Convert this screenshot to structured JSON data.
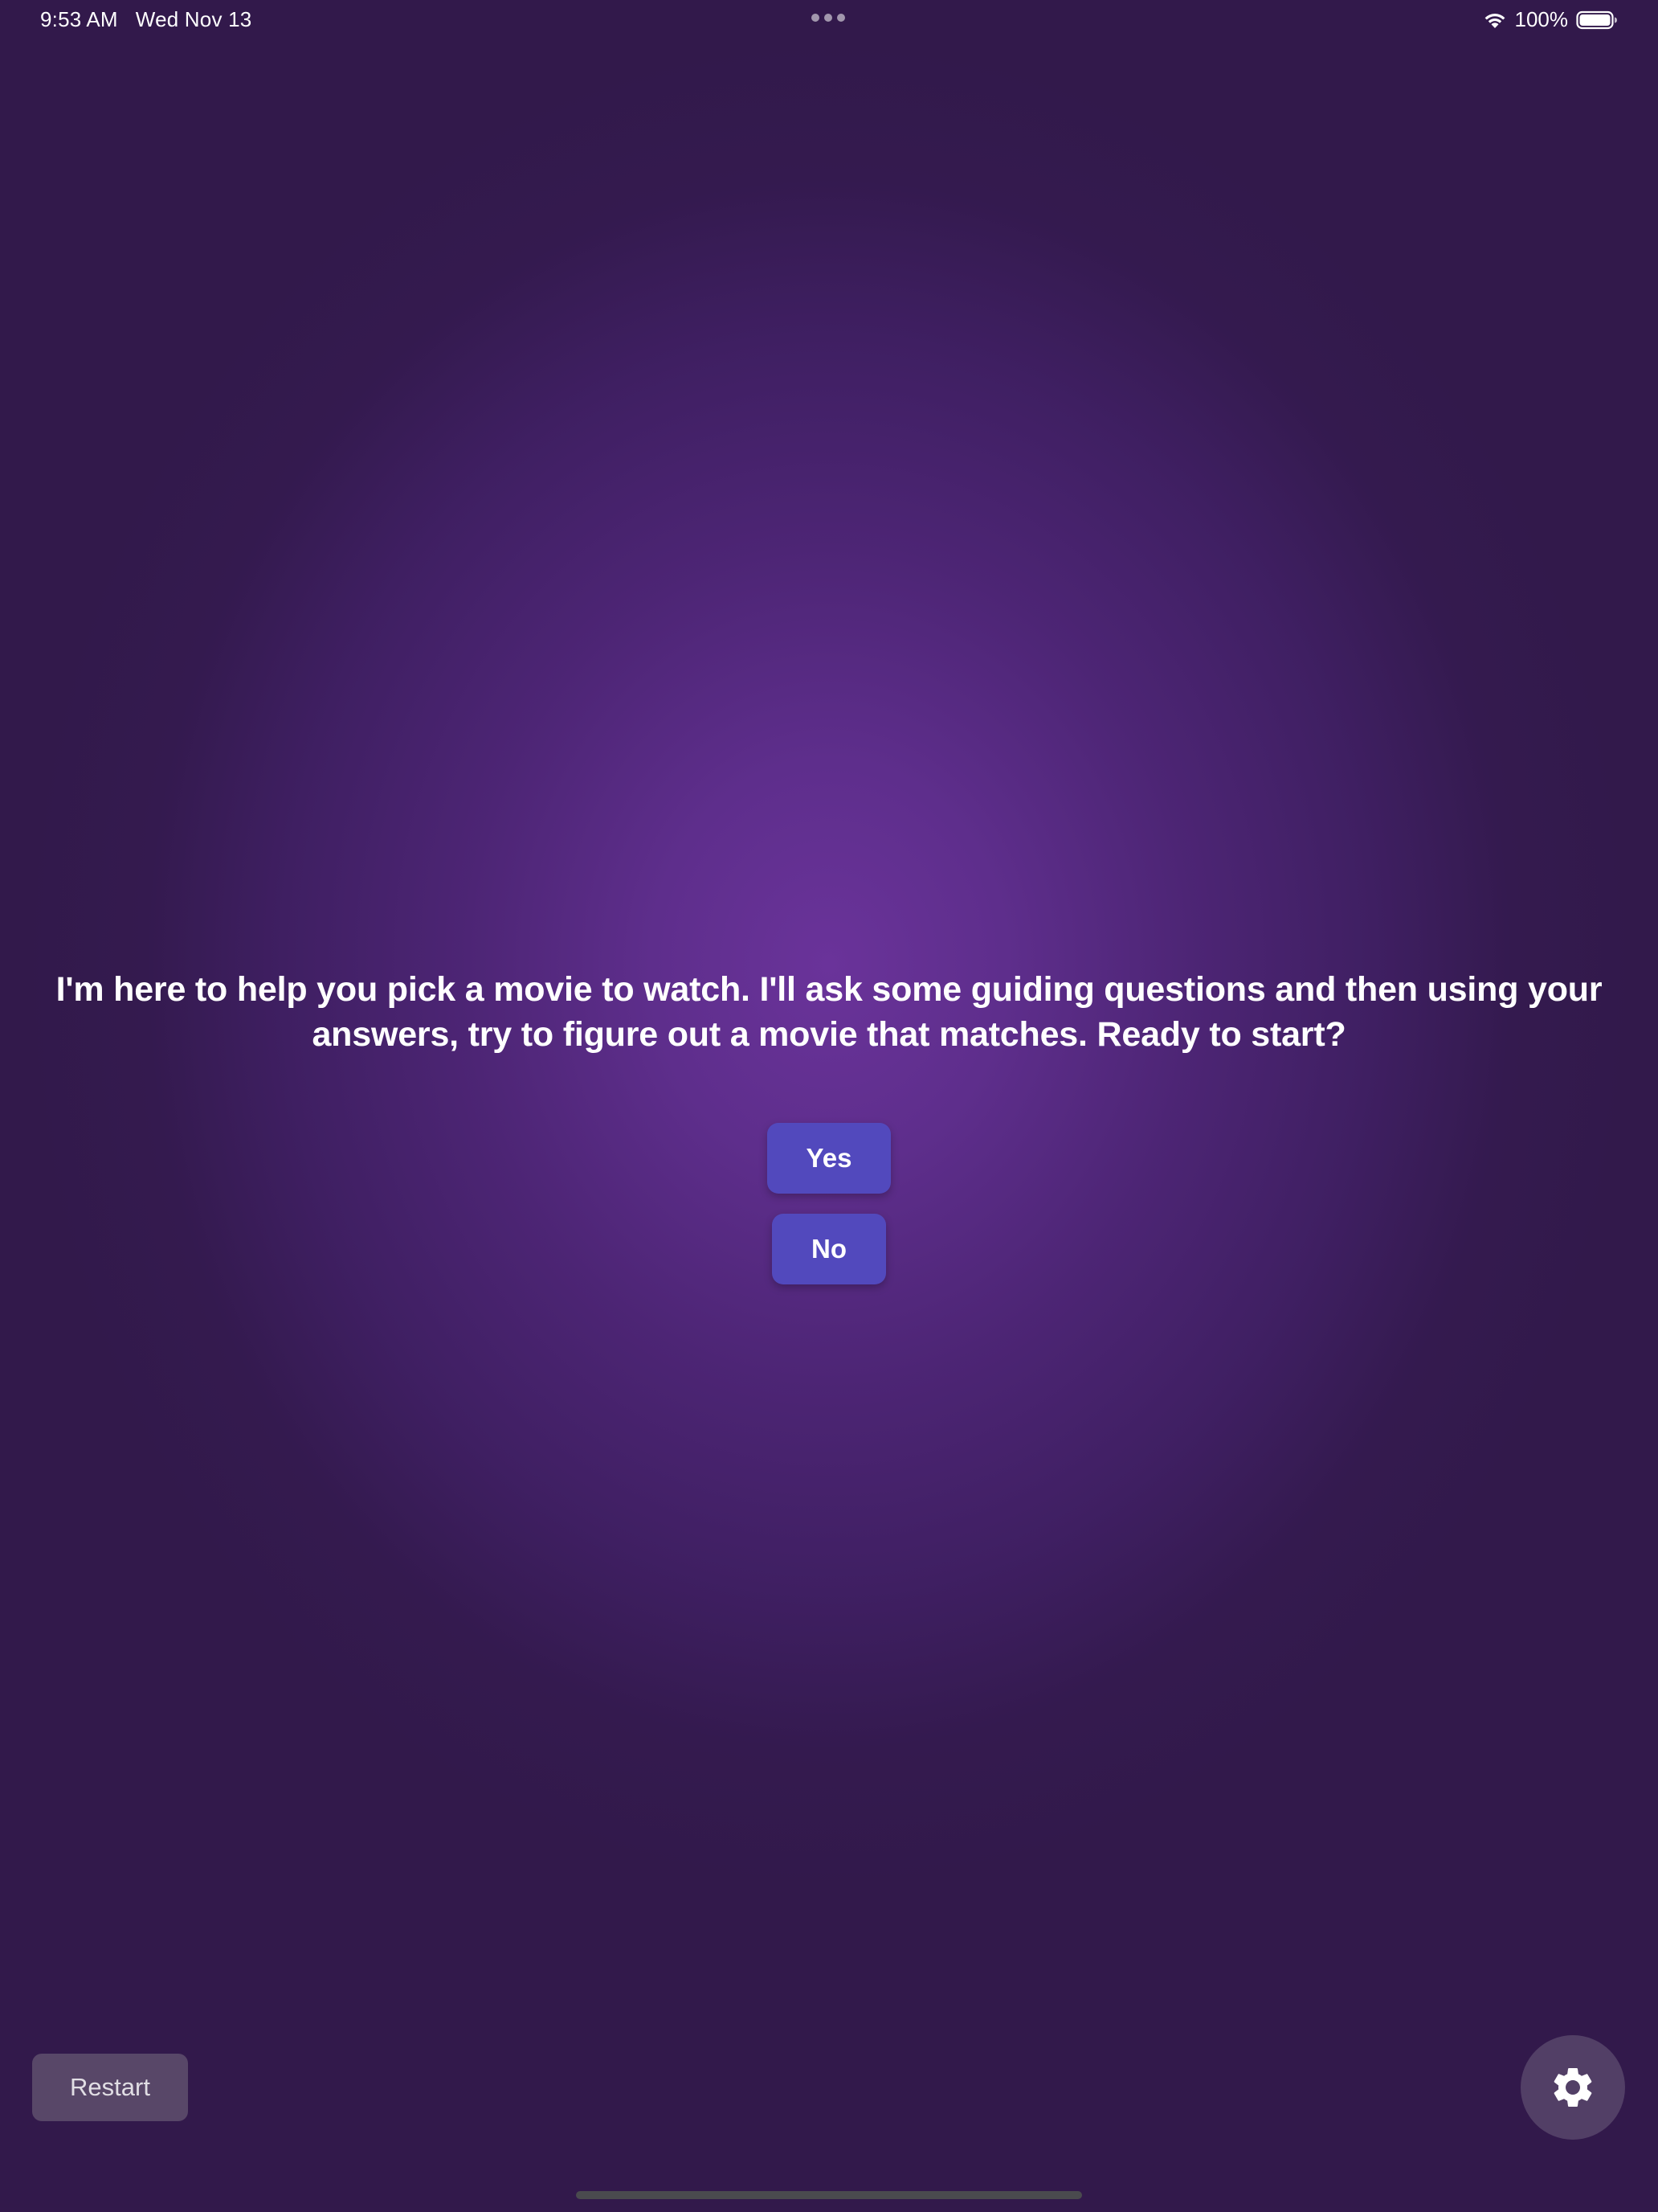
{
  "status_bar": {
    "time": "9:53 AM",
    "date": "Wed Nov 13",
    "battery_percent": "100%",
    "battery_level": 1.0,
    "wifi_icon": "wifi-icon",
    "battery_icon": "battery-full-icon"
  },
  "main": {
    "prompt": "I'm here to help you pick a movie to watch. I'll ask some guiding questions and then using your answers, try to figure out a movie that matches. Ready to start?",
    "answers": [
      {
        "label": "Yes"
      },
      {
        "label": "No"
      }
    ]
  },
  "controls": {
    "restart_label": "Restart",
    "settings_icon": "gear-icon"
  },
  "colors": {
    "background_center": "#6a339a",
    "background_edge": "#32194b",
    "button": "#5249bd",
    "restart_button": "#5c4a6e",
    "settings_button": "#5a4670"
  }
}
